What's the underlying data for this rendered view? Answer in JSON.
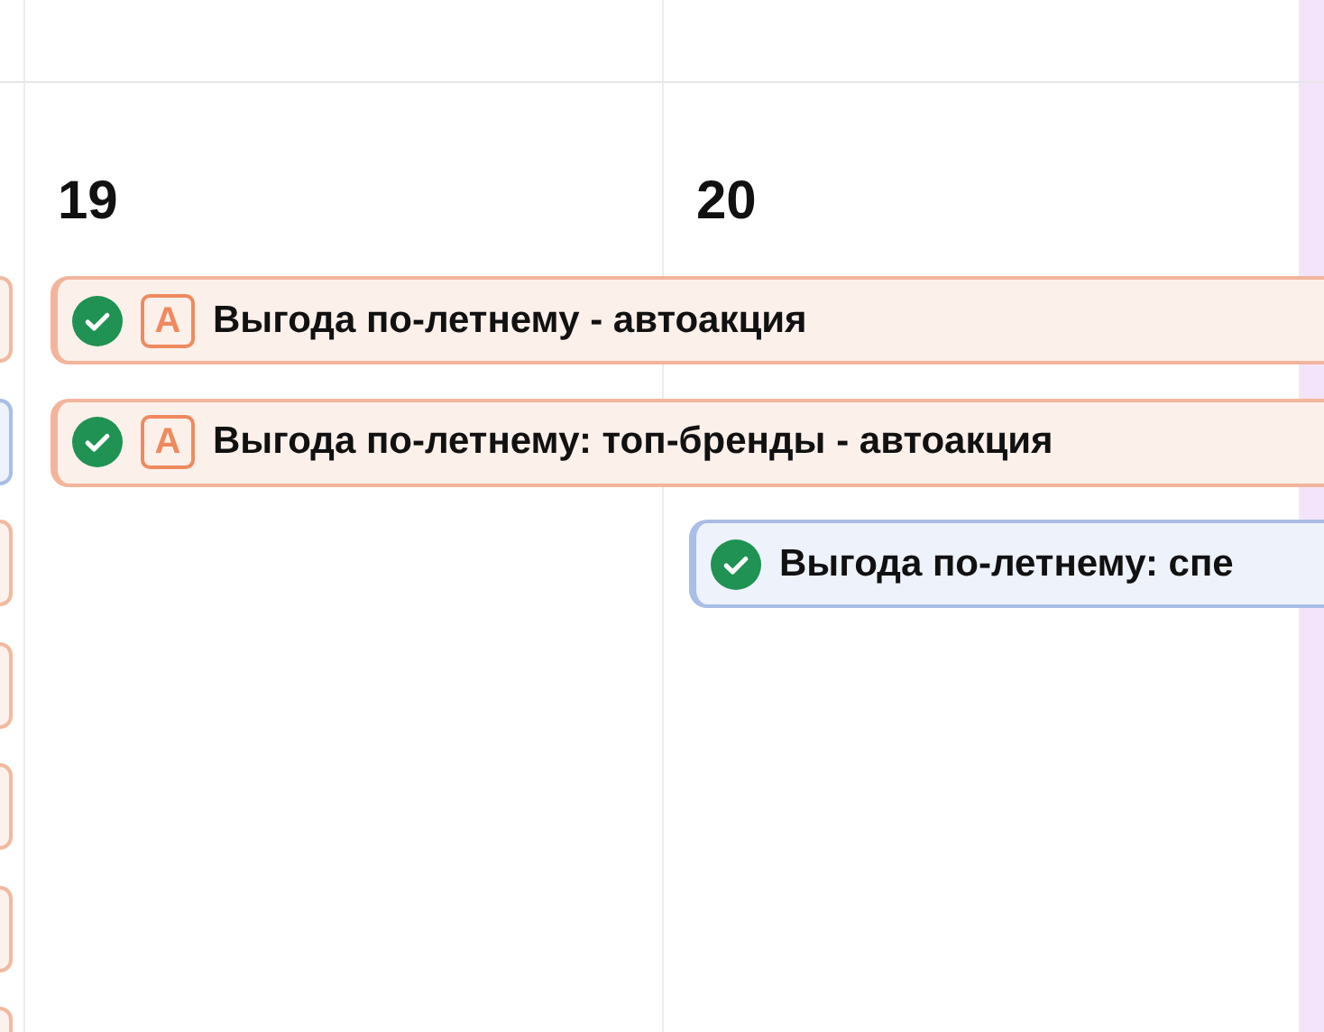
{
  "left_column_events": [
    {
      "color": "#f1b9a0"
    },
    {
      "color": "#a9bde6"
    },
    {
      "color": "#f1b9a0"
    },
    {
      "color": "#f1b9a0"
    },
    {
      "color": "#f1b9a0"
    },
    {
      "color": "#f1b9a0"
    },
    {
      "color": "#f1b9a0"
    }
  ],
  "days": [
    {
      "number": "19",
      "events": [
        {
          "title": "Выгода по-летнему - автоакция",
          "badge": "А",
          "confirmed": true,
          "color": "#f2b59c"
        },
        {
          "title": "Выгода по-летнему: топ-бренды - автоакция",
          "badge": "А",
          "confirmed": true,
          "color": "#f2b59c"
        }
      ]
    },
    {
      "number": "20",
      "events": [
        {
          "title": "Выгода по-летнему: спе",
          "confirmed": true,
          "color": "#a9bde6"
        }
      ]
    }
  ]
}
